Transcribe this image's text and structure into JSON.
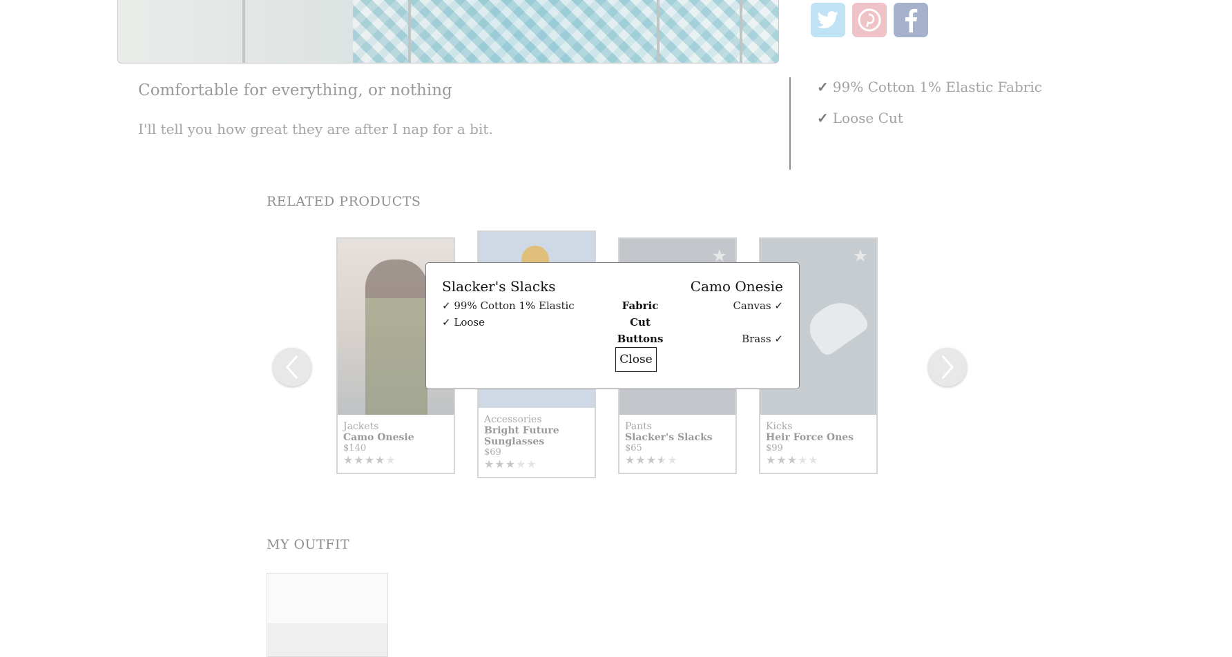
{
  "social": [
    {
      "name": "twitter-icon"
    },
    {
      "name": "pinterest-icon"
    },
    {
      "name": "facebook-icon"
    }
  ],
  "product": {
    "slogan": "Comfortable for everything, or nothing",
    "description": "I'll tell you how great they are after I nap for a bit.",
    "features": [
      "99% Cotton 1% Elastic Fabric",
      "Loose Cut"
    ]
  },
  "related": {
    "title": "RELATED PRODUCTS",
    "cards": [
      {
        "category": "Jackets",
        "name": "Camo Onesie",
        "price": "$140",
        "rating": 4
      },
      {
        "category": "Accessories",
        "name": "Bright Future Sunglasses",
        "price": "$69",
        "rating": 3
      },
      {
        "category": "Pants",
        "name": "Slacker's Slacks",
        "price": "$65",
        "rating": 3.5
      },
      {
        "category": "Kicks",
        "name": "Heir Force Ones",
        "price": "$99",
        "rating": 3
      }
    ]
  },
  "comparison": {
    "left_title": "Slacker's Slacks",
    "right_title": "Camo Onesie",
    "left_values": [
      "99% Cotton 1% Elastic",
      "Loose"
    ],
    "features": [
      "Fabric",
      "Cut",
      "Buttons"
    ],
    "right_values": [
      "Canvas",
      "",
      "Brass"
    ],
    "check": "✓",
    "close_label": "Close"
  },
  "outfit": {
    "title": "MY OUTFIT"
  }
}
